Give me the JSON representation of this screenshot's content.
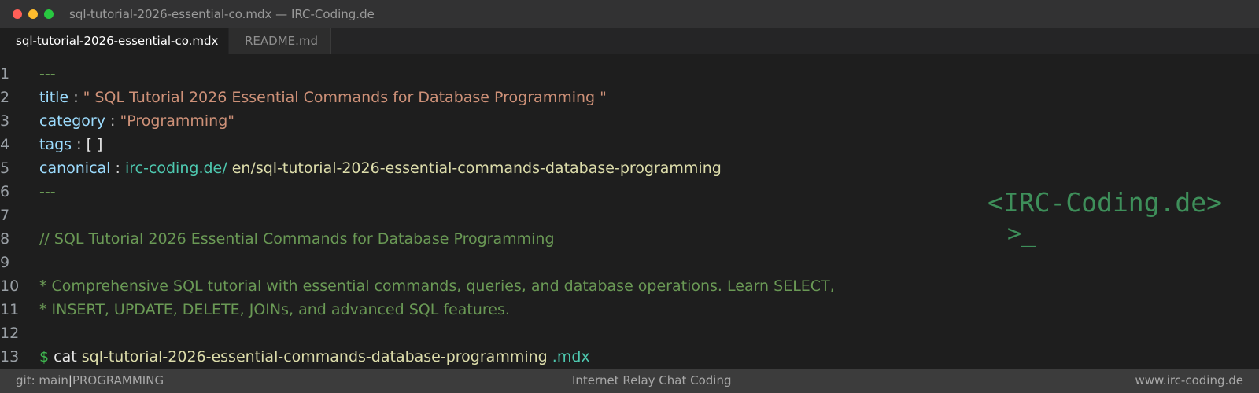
{
  "window": {
    "title": "sql-tutorial-2026-essential-co.mdx — IRC-Coding.de"
  },
  "tabs": [
    {
      "label": "sql-tutorial-2026-essential-co.mdx",
      "active": true
    },
    {
      "label": "README.md",
      "active": false
    }
  ],
  "editor": {
    "lines": [
      {
        "num": "1",
        "frontmatter": "---"
      },
      {
        "num": "2",
        "key": "title",
        "sep": ":",
        "value": "\" SQL Tutorial 2026 Essential Commands for Database Programming \""
      },
      {
        "num": "3",
        "key": "category",
        "sep": ":",
        "value": "\"Programming\""
      },
      {
        "num": "4",
        "key": "tags",
        "sep": ":",
        "value": "[ ]"
      },
      {
        "num": "5",
        "key": "canonical",
        "sep": ":",
        "domain": "irc-coding.de/",
        "path": "en/sql-tutorial-2026-essential-commands-database-programming"
      },
      {
        "num": "6",
        "frontmatter": "---"
      },
      {
        "num": "7"
      },
      {
        "num": "8",
        "comment": "// SQL Tutorial 2026 Essential Commands for Database Programming"
      },
      {
        "num": "9"
      },
      {
        "num": "10",
        "comment": "* Comprehensive SQL tutorial with essential commands, queries, and database operations. Learn SELECT,"
      },
      {
        "num": "11",
        "comment": "* INSERT, UPDATE, DELETE, JOINs, and advanced SQL features."
      },
      {
        "num": "12"
      },
      {
        "num": "13",
        "prompt": "$",
        "cmd": "cat",
        "file": "sql-tutorial-2026-essential-commands-database-programming",
        "ext": ".mdx"
      }
    ]
  },
  "logo": {
    "text": "<IRC-Coding.de>",
    "prompt": ">_"
  },
  "statusbar": {
    "branch": "git: main",
    "divider": "|",
    "category": "PROGRAMMING",
    "center": "Internet Relay Chat Coding",
    "right": "www.irc-coding.de"
  },
  "colors": {
    "background": "#1e1e1e",
    "comment": "#6a9955",
    "key": "#9cdcfe",
    "string": "#ce9178",
    "teal": "#4ec9b0",
    "logo": "#3e8f5a"
  }
}
